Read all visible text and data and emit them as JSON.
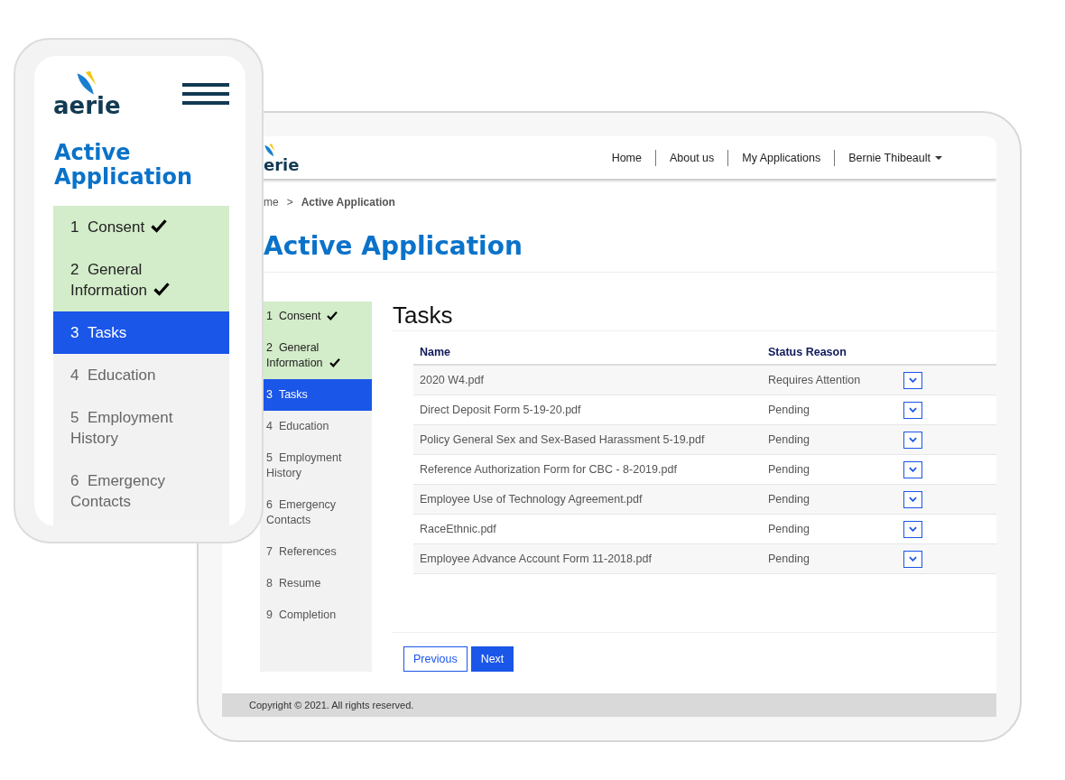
{
  "phone": {
    "logo": "aerie",
    "title": "Active Application",
    "steps": [
      {
        "number": "1",
        "label": "Consent",
        "completed": true,
        "selected": false
      },
      {
        "number": "2",
        "label": "General Information",
        "completed": true,
        "selected": false
      },
      {
        "number": "3",
        "label": "Tasks",
        "completed": false,
        "selected": true
      },
      {
        "number": "4",
        "label": "Education",
        "completed": false,
        "selected": false
      },
      {
        "number": "5",
        "label": "Employment History",
        "completed": false,
        "selected": false
      },
      {
        "number": "6",
        "label": "Emergency Contacts",
        "completed": false,
        "selected": false
      }
    ]
  },
  "tablet": {
    "logo": "erie",
    "nav": [
      "Home",
      "About us",
      "My Applications"
    ],
    "user_menu": "Bernie Thibeault",
    "breadcrumb": {
      "items": [
        "me",
        "Active Application"
      ],
      "separator": ">"
    },
    "title": "Active Application",
    "steps": [
      {
        "number": "1",
        "label": "Consent",
        "completed": true,
        "selected": false
      },
      {
        "number": "2",
        "label": "General Information",
        "completed": true,
        "selected": false
      },
      {
        "number": "3",
        "label": "Tasks",
        "completed": false,
        "selected": true
      },
      {
        "number": "4",
        "label": "Education",
        "completed": false,
        "selected": false
      },
      {
        "number": "5",
        "label": "Employment History",
        "completed": false,
        "selected": false
      },
      {
        "number": "6",
        "label": "Emergency Contacts",
        "completed": false,
        "selected": false
      },
      {
        "number": "7",
        "label": "References",
        "completed": false,
        "selected": false
      },
      {
        "number": "8",
        "label": "Resume",
        "completed": false,
        "selected": false
      },
      {
        "number": "9",
        "label": "Completion",
        "completed": false,
        "selected": false
      }
    ],
    "section_title": "Tasks",
    "table": {
      "columns": [
        "Name",
        "Status Reason"
      ],
      "rows": [
        {
          "name": "2020 W4.pdf",
          "status": "Requires Attention"
        },
        {
          "name": "Direct Deposit Form 5-19-20.pdf",
          "status": "Pending"
        },
        {
          "name": "Policy General Sex and Sex-Based Harassment 5-19.pdf",
          "status": "Pending"
        },
        {
          "name": "Reference Authorization Form for CBC - 8-2019.pdf",
          "status": "Pending"
        },
        {
          "name": "Employee Use of Technology Agreement.pdf",
          "status": "Pending"
        },
        {
          "name": "RaceEthnic.pdf",
          "status": "Pending"
        },
        {
          "name": "Employee Advance Account Form 11-2018.pdf",
          "status": "Pending"
        }
      ]
    },
    "buttons": {
      "previous": "Previous",
      "next": "Next"
    },
    "footer": "Copyright © 2021. All rights reserved."
  }
}
